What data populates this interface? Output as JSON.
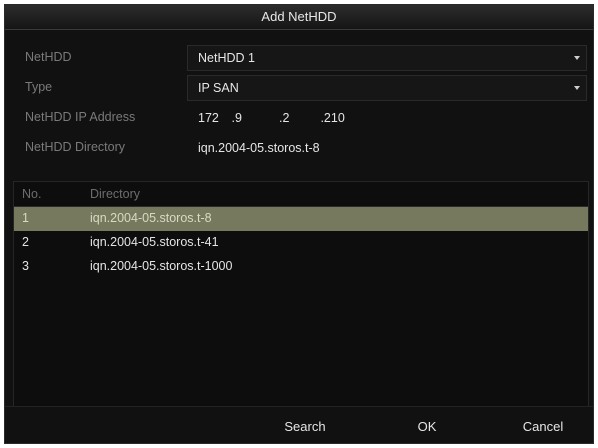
{
  "dialog": {
    "title": "Add NetHDD"
  },
  "form": {
    "nethdd_label": "NetHDD",
    "nethdd_value": "NetHDD 1",
    "type_label": "Type",
    "type_value": "IP SAN",
    "ip_label": "NetHDD IP Address",
    "ip_octets": [
      "172",
      ".9",
      ".2",
      ".210"
    ],
    "dir_label": "NetHDD Directory",
    "dir_value": "iqn.2004-05.storos.t-8"
  },
  "list": {
    "headers": {
      "no": "No.",
      "directory": "Directory"
    },
    "rows": [
      {
        "no": "1",
        "directory": "iqn.2004-05.storos.t-8",
        "selected": true
      },
      {
        "no": "2",
        "directory": "iqn.2004-05.storos.t-41",
        "selected": false
      },
      {
        "no": "3",
        "directory": "iqn.2004-05.storos.t-1000",
        "selected": false
      }
    ]
  },
  "buttons": {
    "search": "Search",
    "ok": "OK",
    "cancel": "Cancel"
  },
  "icons": {
    "dropdown": "chevron-down-icon"
  },
  "colors": {
    "selected_row": "#77795e",
    "background": "#111111"
  }
}
